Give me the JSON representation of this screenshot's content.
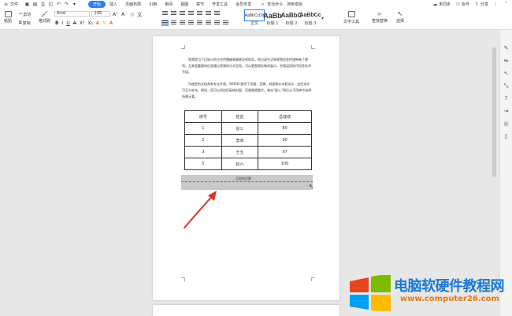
{
  "menubar": {
    "file_label": "文件",
    "tabs": [
      "开始",
      "插入",
      "页面布局",
      "引用",
      "审阅",
      "视图",
      "章节",
      "开发工具",
      "会员专享"
    ],
    "active_tab": "开始",
    "search_label": "查找命令、搜索模板",
    "right": {
      "unsync": "未同步",
      "collab": "协作",
      "share": "分享"
    }
  },
  "ribbon": {
    "paste": "粘贴",
    "cut": "剪切",
    "copy": "复制",
    "format_painter": "格式刷",
    "font_name": "Arial",
    "font_size": "小四",
    "styles": [
      {
        "sample": "AaBbCcDd",
        "name": "正文"
      },
      {
        "sample": "AaBb",
        "name": "标题 1"
      },
      {
        "sample": "AaBbC",
        "name": "标题 2"
      },
      {
        "sample": "AaBbCc",
        "name": "标题 3"
      }
    ],
    "text_tool": "文字工具",
    "find_replace": "查找替换",
    "select": "选择"
  },
  "document": {
    "para1": "视频是当下比较火的方式传播越来越普及的现实，给记录生活和视频信息传递带来了便利。尤其是重要的信息通过视频的方式呈现，可以更直观形象的展示，合理运用现代信息技术手段。",
    "para2": "为使您的文档具有专业外观，WORD 提供了页眉、页脚、封面和文本框设计，这些设计可互为补充。例如，您可以添加匹配的封面、页眉和提要栏。单击“插入”然后从不同库中选择所需元素。",
    "table": {
      "headers": [
        "序号",
        "姓名",
        "总成绩"
      ],
      "rows": [
        [
          "1",
          "张三",
          "80"
        ],
        [
          "2",
          "李四",
          "90"
        ],
        [
          "3",
          "王五",
          "97"
        ],
        [
          "5",
          "赵六",
          "100"
        ]
      ]
    },
    "header_footer_label": "页眉和页脚"
  },
  "watermark": {
    "title": "电脑软硬件教程网",
    "url": "www.computer26.com"
  },
  "colors": {
    "accent": "#2e7cf6",
    "watermark_blue": "#1b78d8",
    "watermark_orange": "#e07b14",
    "arrow": "#d9342b"
  }
}
